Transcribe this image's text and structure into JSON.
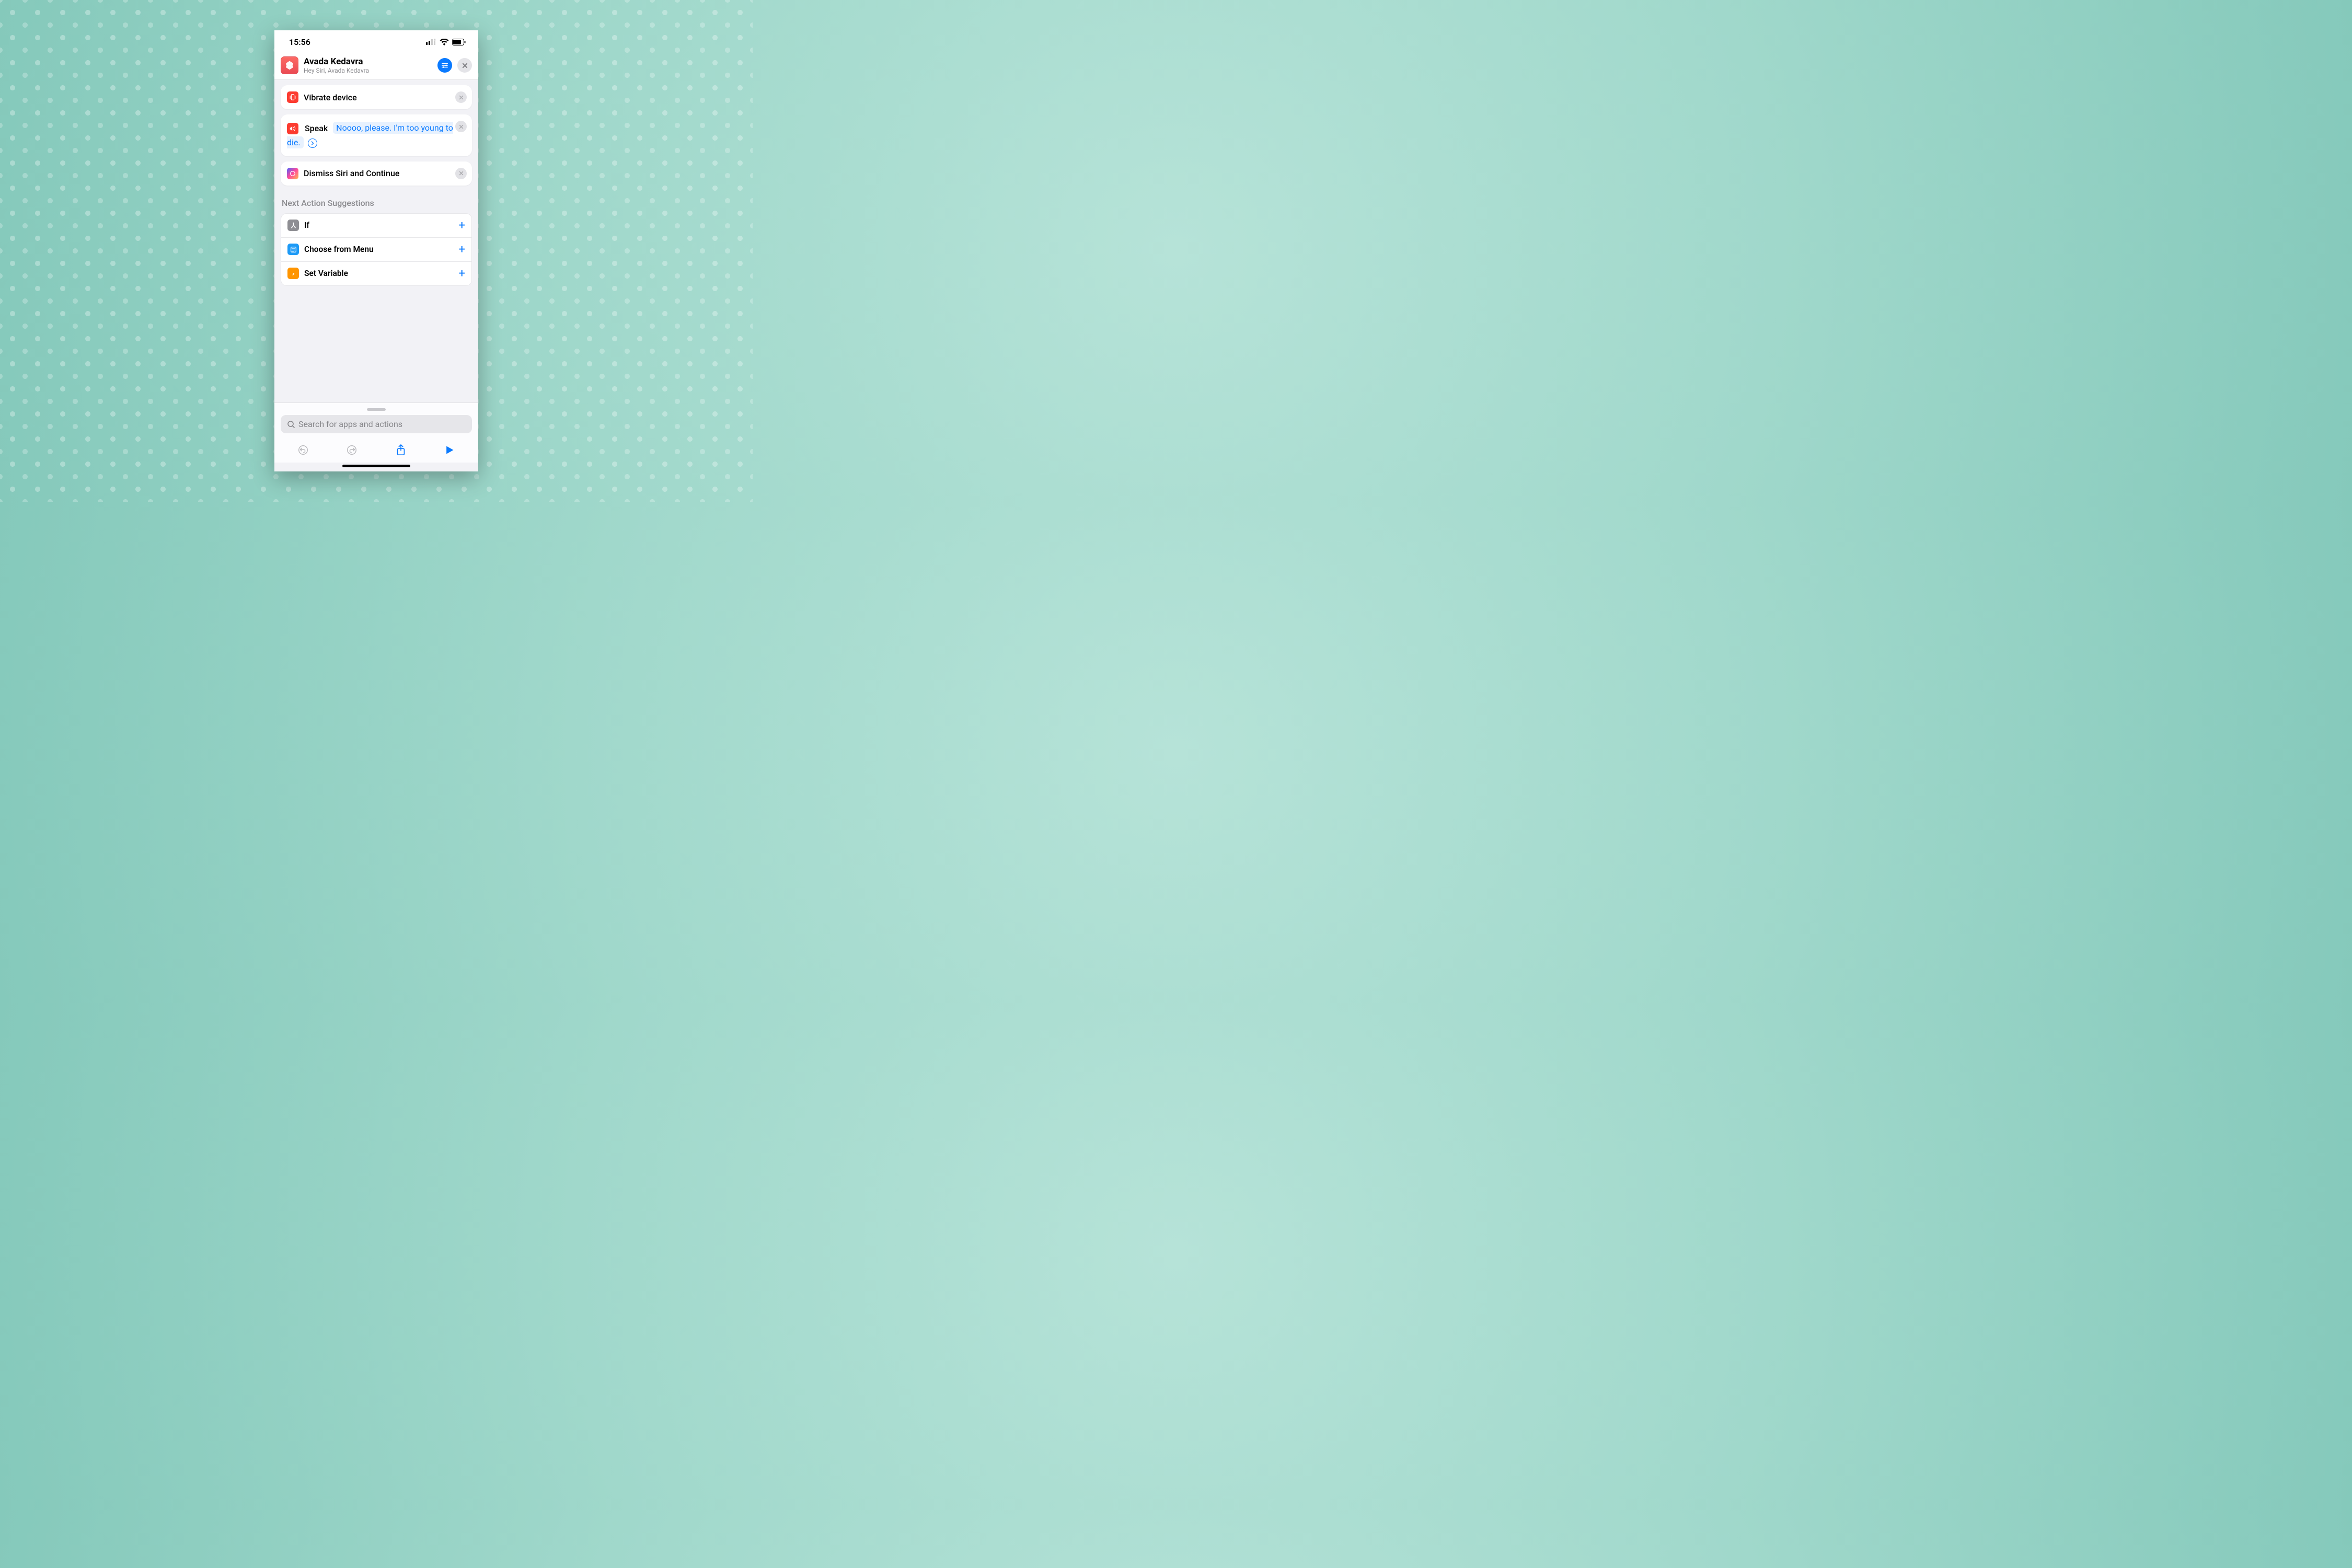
{
  "status": {
    "time": "15:56"
  },
  "header": {
    "title": "Avada Kedavra",
    "subtitle": "Hey Siri, Avada Kedavra"
  },
  "actions": [
    {
      "icon": "vibrate",
      "label": "Vibrate device"
    },
    {
      "icon": "speak",
      "label": "Speak",
      "param": "Noooo, please. I'm too young to die."
    },
    {
      "icon": "siri",
      "label": "Dismiss Siri and Continue"
    }
  ],
  "suggestions_title": "Next Action Suggestions",
  "suggestions": [
    {
      "icon": "if",
      "label": "If"
    },
    {
      "icon": "menu",
      "label": "Choose from Menu"
    },
    {
      "icon": "var",
      "label": "Set Variable"
    }
  ],
  "search": {
    "placeholder": "Search for apps and actions"
  }
}
